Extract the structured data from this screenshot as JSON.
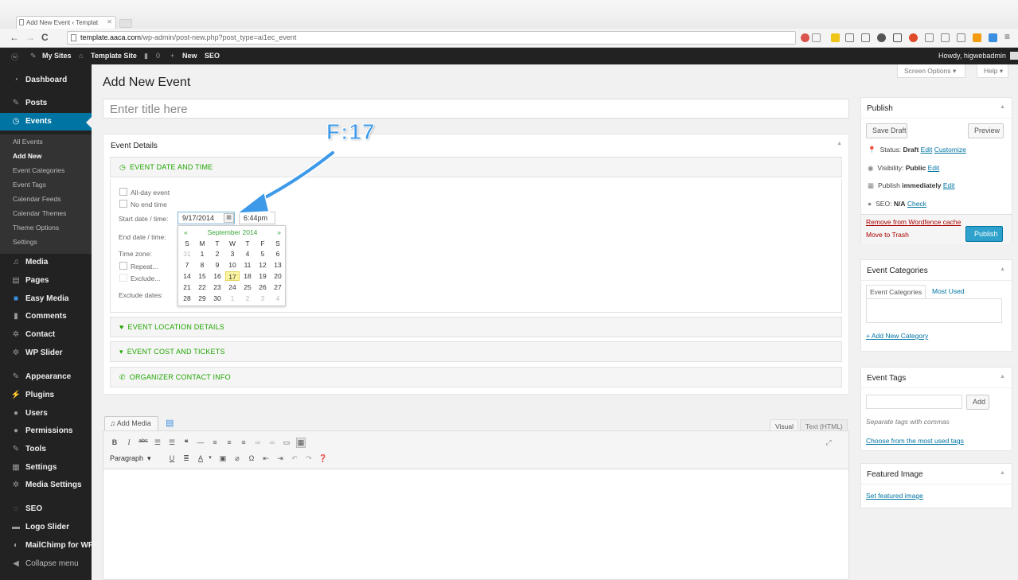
{
  "browser": {
    "tab_title": "Add New Event ‹ Templat",
    "url_host": "template.aaca.com",
    "url_path": "/wp-admin/post-new.php?post_type=ai1ec_event"
  },
  "adminbar": {
    "my_sites": "My Sites",
    "site_name": "Template Site",
    "comments_count": "0",
    "new": "New",
    "seo": "SEO",
    "howdy": "Howdy, higwebadmin"
  },
  "sidebar": {
    "items": {
      "dashboard": "Dashboard",
      "posts": "Posts",
      "events": "Events",
      "media": "Media",
      "pages": "Pages",
      "easy_media": "Easy Media",
      "comments": "Comments",
      "contact": "Contact",
      "wp_slider": "WP Slider",
      "appearance": "Appearance",
      "plugins": "Plugins",
      "users": "Users",
      "permissions": "Permissions",
      "tools": "Tools",
      "settings": "Settings",
      "media_settings": "Media Settings",
      "seo": "SEO",
      "logo_slider": "Logo Slider",
      "mailchimp": "MailChimp for WP",
      "collapse": "Collapse menu"
    },
    "submenu": {
      "all_events": "All Events",
      "add_new": "Add New",
      "event_categories": "Event Categories",
      "event_tags": "Event Tags",
      "calendar_feeds": "Calendar Feeds",
      "calendar_themes": "Calendar Themes",
      "theme_options": "Theme Options",
      "settings": "Settings"
    }
  },
  "screen_options": "Screen Options",
  "help": "Help",
  "page_title": "Add New Event",
  "title_placeholder": "Enter title here",
  "event_details": {
    "heading": "Event Details",
    "date_section": "EVENT DATE AND TIME",
    "all_day": "All-day event",
    "no_end_time": "No end time",
    "start_label": "Start date / time:",
    "start_date": "9/17/2014",
    "start_time": "6:44pm",
    "end_label": "End date / time:",
    "timezone_label": "Time zone:",
    "repeat": "Repeat...",
    "exclude": "Exclude...",
    "exclude_dates": "Exclude dates:",
    "location_section": "EVENT LOCATION DETAILS",
    "cost_section": "EVENT COST AND TICKETS",
    "organizer_section": "ORGANIZER CONTACT INFO"
  },
  "calendar": {
    "prev": "«",
    "next": "»",
    "month": "September 2014",
    "dow": [
      "S",
      "M",
      "T",
      "W",
      "T",
      "F",
      "S"
    ],
    "weeks": [
      [
        "31",
        "1",
        "2",
        "3",
        "4",
        "5",
        "6"
      ],
      [
        "7",
        "8",
        "9",
        "10",
        "11",
        "12",
        "13"
      ],
      [
        "14",
        "15",
        "16",
        "17",
        "18",
        "19",
        "20"
      ],
      [
        "21",
        "22",
        "23",
        "24",
        "25",
        "26",
        "27"
      ],
      [
        "28",
        "29",
        "30",
        "1",
        "2",
        "3",
        "4"
      ]
    ],
    "selected": "17"
  },
  "annotation": "F:17",
  "editor": {
    "add_media": "Add Media",
    "tab_visual": "Visual",
    "tab_text": "Text (HTML)",
    "paragraph": "Paragraph"
  },
  "publish": {
    "heading": "Publish",
    "save_draft": "Save Draft",
    "preview": "Preview",
    "status_label": "Status:",
    "status_value": "Draft",
    "visibility_label": "Visibility:",
    "visibility_value": "Public",
    "publish_label": "Publish",
    "publish_value": "immediately",
    "seo_label": "SEO:",
    "seo_value": "N/A",
    "edit": "Edit",
    "customize": "Customize",
    "check": "Check",
    "wordfence": "Remove from Wordfence cache",
    "trash": "Move to Trash",
    "publish_button": "Publish"
  },
  "categories": {
    "heading": "Event Categories",
    "tab_all": "Event Categories",
    "tab_used": "Most Used",
    "add_new": "+ Add New Category"
  },
  "tags": {
    "heading": "Event Tags",
    "add": "Add",
    "hint": "Separate tags with commas",
    "choose": "Choose from the most used tags"
  },
  "featured": {
    "heading": "Featured Image",
    "set": "Set featured image"
  },
  "colors": {
    "admin_bar": "#222222",
    "accent_blue": "#0074a2",
    "section_green": "#20a400",
    "annotation_blue": "#3d9ae8",
    "today_highlight": "#fcf3a0"
  }
}
